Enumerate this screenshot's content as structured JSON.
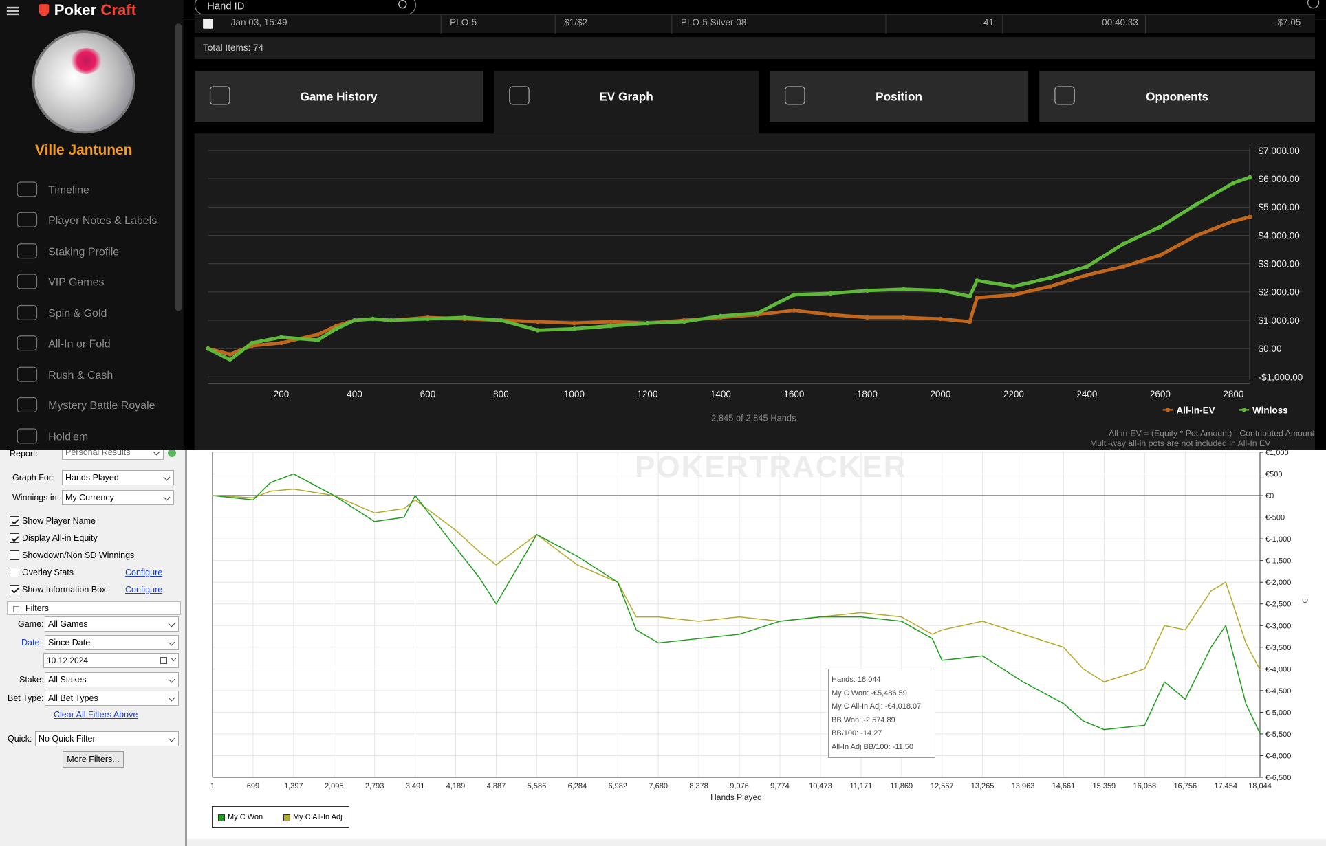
{
  "pokercraft": {
    "brand": {
      "poker": "Poker",
      "craft": "Craft"
    },
    "user": {
      "name": "Ville Jantunen"
    },
    "nav": [
      "Timeline",
      "Player Notes & Labels",
      "Staking Profile",
      "VIP Games",
      "Spin & Gold",
      "All-In or Fold",
      "Rush & Cash",
      "Mystery Battle Royale",
      "Hold'em"
    ],
    "search": {
      "placeholder": "Hand ID"
    },
    "hand_row": {
      "date": "Jan 03, 15:49",
      "game": "PLO-5",
      "stakes": "$1/$2",
      "table": "PLO-5 Silver 08",
      "count": "41",
      "duration": "00:40:33",
      "result": "-$7.05"
    },
    "total_items": "Total Items: 74",
    "tabs": [
      "Game History",
      "EV Graph",
      "Position",
      "Opponents"
    ],
    "hands_caption": "2,845 of 2,845 Hands",
    "note_line1": "All-in-EV = (Equity * Pot Amount) - Contributed Amount",
    "note_line2": "Multi-way all-in pots are not included in All-In EV calculation.",
    "colors": {
      "allin_ev": "#c0661d",
      "winloss": "#5fb83a",
      "accent": "#f39c24"
    }
  },
  "chart_data": [
    {
      "type": "line",
      "x_ticks": [
        "200",
        "400",
        "600",
        "800",
        "1000",
        "1200",
        "1400",
        "1600",
        "1800",
        "2000",
        "2200",
        "2400",
        "2600",
        "2800"
      ],
      "y_ticks": [
        "$7,000.00",
        "$6,000.00",
        "$5,000.00",
        "$4,000.00",
        "$3,000.00",
        "$2,000.00",
        "$1,000.00",
        "$0.00",
        "-$1,000.00"
      ],
      "xlim": [
        0,
        2845
      ],
      "ylim": [
        -1000,
        7000
      ],
      "grid": true,
      "legend": "bottom-right",
      "series": [
        {
          "name": "All-in-EV",
          "color": "#c0661d",
          "x": [
            0,
            60,
            120,
            200,
            300,
            350,
            400,
            450,
            500,
            600,
            700,
            800,
            900,
            1000,
            1100,
            1200,
            1300,
            1400,
            1500,
            1600,
            1700,
            1800,
            1900,
            2000,
            2080,
            2100,
            2200,
            2300,
            2400,
            2500,
            2600,
            2700,
            2800,
            2845
          ],
          "values": [
            0,
            -200,
            100,
            200,
            500,
            800,
            1000,
            1050,
            1000,
            1100,
            1050,
            1000,
            950,
            900,
            950,
            900,
            1000,
            1100,
            1200,
            1350,
            1200,
            1100,
            1100,
            1050,
            950,
            1800,
            1900,
            2200,
            2600,
            2900,
            3300,
            4000,
            4500,
            4650
          ]
        },
        {
          "name": "Winloss",
          "color": "#5fb83a",
          "x": [
            0,
            60,
            120,
            200,
            300,
            350,
            400,
            450,
            500,
            600,
            700,
            800,
            900,
            1000,
            1100,
            1200,
            1300,
            1400,
            1500,
            1600,
            1700,
            1800,
            1900,
            2000,
            2080,
            2100,
            2200,
            2300,
            2400,
            2500,
            2600,
            2700,
            2800,
            2845
          ],
          "values": [
            0,
            -400,
            200,
            400,
            300,
            700,
            1000,
            1050,
            1000,
            1050,
            1100,
            1000,
            650,
            700,
            800,
            900,
            950,
            1150,
            1250,
            1900,
            1950,
            2050,
            2100,
            2050,
            1850,
            2400,
            2200,
            2500,
            2900,
            3700,
            4300,
            5100,
            5850,
            6050
          ]
        }
      ]
    },
    {
      "type": "line",
      "xlabel": "Hands Played",
      "x_ticks": [
        "1",
        "699",
        "1,397",
        "2,095",
        "2,793",
        "3,491",
        "4,189",
        "4,887",
        "5,586",
        "6,284",
        "6,982",
        "7,680",
        "8,378",
        "9,076",
        "9,774",
        "10,473",
        "11,171",
        "11,869",
        "12,567",
        "13,265",
        "13,963",
        "14,661",
        "15,359",
        "16,058",
        "16,756",
        "17,454",
        "18,044"
      ],
      "y_ticks": [
        "€1,000",
        "€500",
        "€0",
        "€-500",
        "€-1,000",
        "€-1,500",
        "€-2,000",
        "€-2,500",
        "€-3,000",
        "€-3,500",
        "€-4,000",
        "€-4,500",
        "€-5,000",
        "€-5,500",
        "€-6,000",
        "€-6,500"
      ],
      "xlim": [
        1,
        18044
      ],
      "ylim": [
        -6500,
        1000
      ],
      "grid": true,
      "legend": "bottom-left",
      "series": [
        {
          "name": "My C Won",
          "color": "#1f9e1f",
          "x": [
            1,
            700,
            1000,
            1397,
            2095,
            2793,
            3300,
            3491,
            4189,
            4600,
            4887,
            5586,
            6284,
            6982,
            7300,
            7680,
            8378,
            9076,
            9774,
            10473,
            11171,
            11869,
            12400,
            12567,
            13265,
            13963,
            14661,
            15000,
            15359,
            16058,
            16400,
            16756,
            17200,
            17454,
            17800,
            18044
          ],
          "values": [
            0,
            -100,
            300,
            500,
            0,
            -600,
            -500,
            0,
            -1200,
            -1900,
            -2500,
            -900,
            -1400,
            -2000,
            -3100,
            -3400,
            -3300,
            -3200,
            -2900,
            -2800,
            -2800,
            -2900,
            -3300,
            -3800,
            -3700,
            -4300,
            -4800,
            -5200,
            -5400,
            -5300,
            -4300,
            -4700,
            -3500,
            -3000,
            -4800,
            -5486.59
          ]
        },
        {
          "name": "My C All-In Adj",
          "color": "#b5a92a",
          "x": [
            1,
            700,
            1000,
            1397,
            2095,
            2793,
            3300,
            3491,
            4189,
            4600,
            4887,
            5586,
            6284,
            6982,
            7300,
            7680,
            8378,
            9076,
            9774,
            10473,
            11171,
            11869,
            12400,
            12567,
            13265,
            13963,
            14661,
            15000,
            15359,
            16058,
            16400,
            16756,
            17200,
            17454,
            17800,
            18044
          ],
          "values": [
            0,
            -50,
            100,
            150,
            0,
            -400,
            -300,
            -100,
            -800,
            -1300,
            -1600,
            -900,
            -1600,
            -2000,
            -2800,
            -2800,
            -2900,
            -2800,
            -2900,
            -2800,
            -2700,
            -2800,
            -3200,
            -3100,
            -2900,
            -3200,
            -3500,
            -4000,
            -4300,
            -4000,
            -3000,
            -3100,
            -2200,
            -2000,
            -3400,
            -4018.07
          ]
        }
      ]
    }
  ],
  "pokertracker": {
    "watermark": "POKERTRACKER",
    "report_label": "Report:",
    "report_value": "Personal Results",
    "graph_for_label": "Graph For:",
    "graph_for_value": "Hands Played",
    "winnings_label": "Winnings in:",
    "winnings_value": "My Currency",
    "show_player_name": "Show Player Name",
    "display_allin": "Display All-in Equity",
    "showdown": "Showdown/Non SD Winnings",
    "overlay": "Overlay Stats",
    "show_info": "Show Information Box",
    "configure": "Configure",
    "filters": "Filters",
    "game_label": "Game:",
    "game_value": "All Games",
    "date_label": "Date:",
    "date_value": "Since Date",
    "date_input": "10.12.2024",
    "stake_label": "Stake:",
    "stake_value": "All Stakes",
    "bettype_label": "Bet Type:",
    "bettype_value": "All Bet Types",
    "clear_filters": "Clear All Filters Above",
    "quick_label": "Quick:",
    "quick_value": "No Quick Filter",
    "more_filters": "More Filters...",
    "tooltip": [
      "Hands: 18,044",
      "My C Won: -€5,486.59",
      "My C All-In Adj: -€4,018.07",
      "BB Won: -2,574.89",
      "BB/100: -14.27",
      "All-In Adj BB/100: -11.50"
    ],
    "currency_symbol": "Ψ"
  }
}
